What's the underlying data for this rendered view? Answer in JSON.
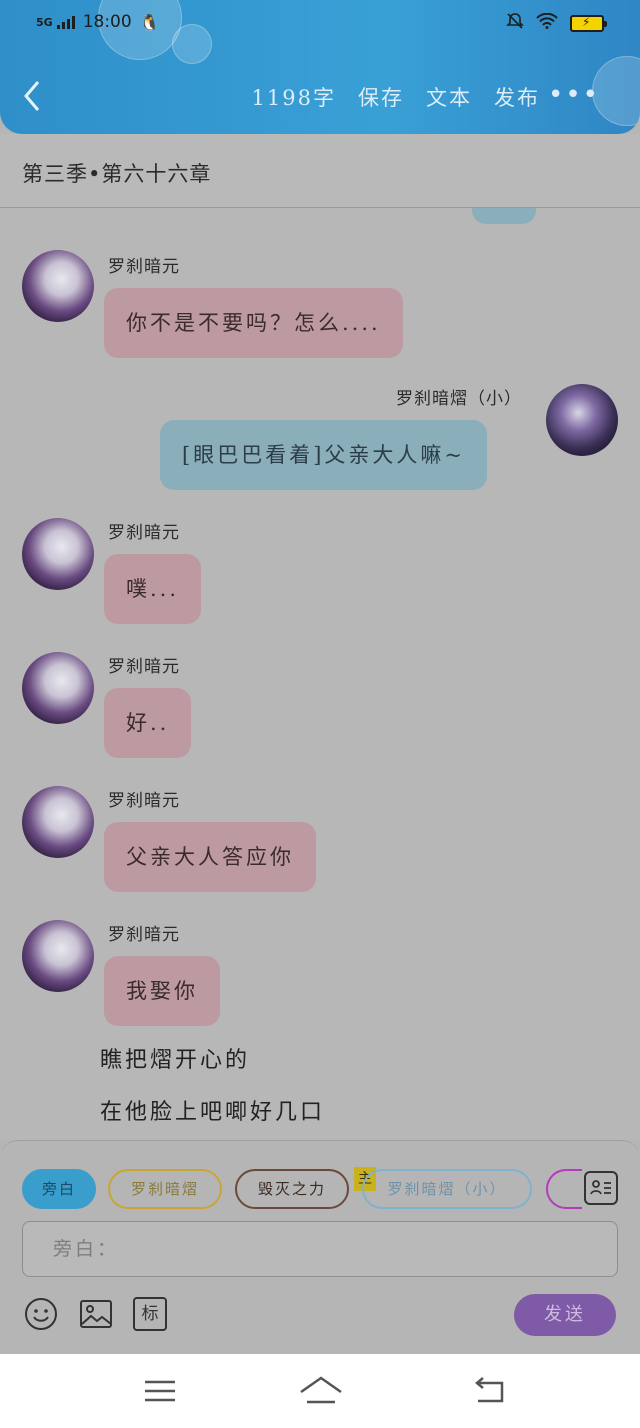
{
  "status_bar": {
    "network": "5G",
    "time": "18:00"
  },
  "header": {
    "word_count": "1198字",
    "save": "保存",
    "text": "文本",
    "publish": "发布",
    "more": "•••"
  },
  "chapter": {
    "title": "第三季•第六十六章"
  },
  "messages": [
    {
      "side": "left",
      "name": "罗刹暗元",
      "text": "你不是不要吗？怎么...."
    },
    {
      "side": "right",
      "name": "罗刹暗熠（小）",
      "text": "[眼巴巴看着]父亲大人嘛~"
    },
    {
      "side": "left",
      "name": "罗刹暗元",
      "text": "噗..."
    },
    {
      "side": "left",
      "name": "罗刹暗元",
      "text": "好.."
    },
    {
      "side": "left",
      "name": "罗刹暗元",
      "text": "父亲大人答应你"
    },
    {
      "side": "left",
      "name": "罗刹暗元",
      "text": "我娶你"
    }
  ],
  "narration": [
    "瞧把熠开心的",
    "在他脸上吧唧好几口"
  ],
  "roles": {
    "items": [
      "旁白",
      "罗刹暗熠",
      "毁灭之力",
      "罗刹暗熠（小）"
    ],
    "tag": "主"
  },
  "composer": {
    "placeholder": "旁白：",
    "send_label": "发送",
    "tag_button": "标"
  },
  "colors": {
    "header_blue": "#39a0d6",
    "pink_bubble": "#bd9aa2",
    "blue_bubble": "#8aaeba",
    "send_purple": "#7f5aa6"
  }
}
